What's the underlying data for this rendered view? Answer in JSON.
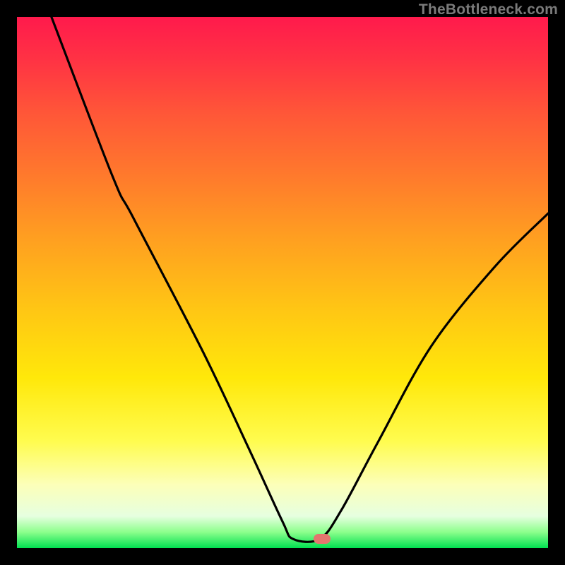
{
  "watermark": "TheBottleneck.com",
  "chart_data": {
    "type": "line",
    "title": "",
    "xlabel": "",
    "ylabel": "",
    "xlim": [
      0,
      100
    ],
    "ylim": [
      0,
      100
    ],
    "grid": false,
    "curve_points": [
      {
        "x": 6.5,
        "y": 100
      },
      {
        "x": 18,
        "y": 70
      },
      {
        "x": 22,
        "y": 62
      },
      {
        "x": 35,
        "y": 37
      },
      {
        "x": 44,
        "y": 18
      },
      {
        "x": 50,
        "y": 5
      },
      {
        "x": 52,
        "y": 1.7
      },
      {
        "x": 57,
        "y": 1.7
      },
      {
        "x": 61,
        "y": 7
      },
      {
        "x": 68,
        "y": 20
      },
      {
        "x": 78,
        "y": 38
      },
      {
        "x": 90,
        "y": 53
      },
      {
        "x": 100,
        "y": 63
      }
    ],
    "marker": {
      "x": 57.5,
      "y": 1.7,
      "color": "#e4766e"
    },
    "gradient_stops": [
      {
        "pct": 0,
        "color": "#ff1a4c"
      },
      {
        "pct": 8,
        "color": "#ff3244"
      },
      {
        "pct": 18,
        "color": "#ff5638"
      },
      {
        "pct": 30,
        "color": "#ff7a2c"
      },
      {
        "pct": 42,
        "color": "#ffa020"
      },
      {
        "pct": 55,
        "color": "#ffc614"
      },
      {
        "pct": 68,
        "color": "#ffe80a"
      },
      {
        "pct": 80,
        "color": "#fffc50"
      },
      {
        "pct": 88,
        "color": "#fcffb8"
      },
      {
        "pct": 94,
        "color": "#e6ffe0"
      },
      {
        "pct": 97,
        "color": "#8cff8c"
      },
      {
        "pct": 100,
        "color": "#00e050"
      }
    ]
  }
}
